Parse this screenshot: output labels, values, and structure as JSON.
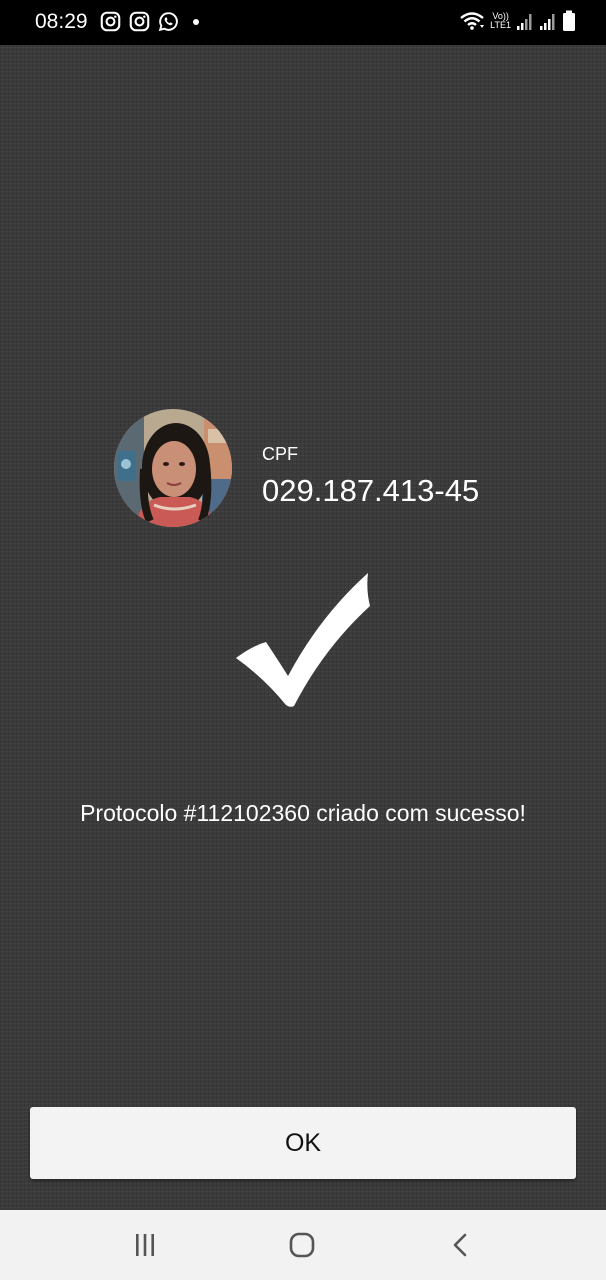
{
  "status_bar": {
    "time": "08:29",
    "left_icons": [
      "instagram-icon",
      "instagram-icon",
      "whatsapp-icon",
      "notification-dot-icon"
    ],
    "right_icons": [
      "wifi-icon",
      "volte-lte-icon",
      "signal-icon",
      "signal-icon",
      "battery-icon"
    ],
    "lte_line1": "Vo))",
    "lte_line2": "LTE1"
  },
  "profile": {
    "avatar": "avatar-photo",
    "cpf_label": "CPF",
    "cpf_value": "029.187.413-45"
  },
  "success": {
    "icon": "checkmark-icon",
    "message": "Protocolo #112102360 criado com sucesso!"
  },
  "actions": {
    "ok_label": "OK"
  },
  "nav_bar": {
    "buttons": [
      "recent-apps-icon",
      "home-icon",
      "back-icon"
    ]
  },
  "colors": {
    "background": "#3b3b3b",
    "status_bar": "#000000",
    "text": "#ffffff",
    "button": "#f3f3f3",
    "nav_bar": "#f2f2f2"
  }
}
